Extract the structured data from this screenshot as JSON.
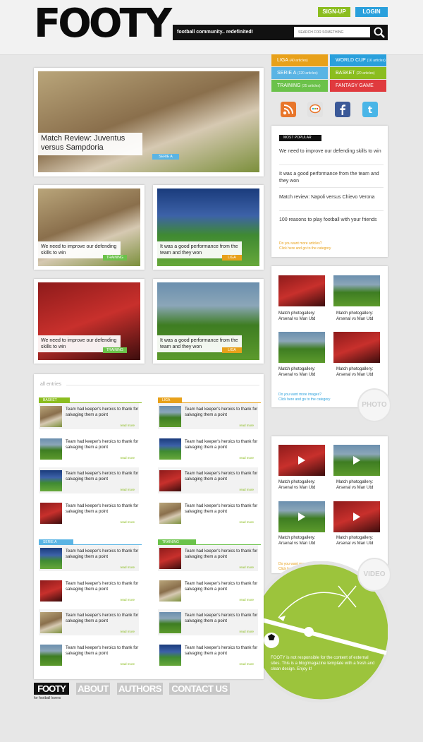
{
  "header": {
    "logo": "FOOTY",
    "signup": "SIGN-UP",
    "login": "LOGIN",
    "tagline": "football community.. redefinited!",
    "search_placeholder": "SEARCH FOR SOMETHING"
  },
  "categories": [
    {
      "label": "LIGA",
      "count": "(40 articles)",
      "color": "#e8a11a"
    },
    {
      "label": "WORLD CUP",
      "count": "(16 articles)",
      "color": "#2aa0dc"
    },
    {
      "label": "SERIE A",
      "count": "(120 articles)",
      "color": "#5ab4e4"
    },
    {
      "label": "BASKET",
      "count": "(20 articles)",
      "color": "#8bbd1f"
    },
    {
      "label": "TRAINING",
      "count": "(25 articles)",
      "color": "#6bc24a"
    },
    {
      "label": "FANTASY GAME",
      "count": "",
      "color": "#e03a3e"
    }
  ],
  "social": [
    {
      "icon": "rss-icon",
      "color": "#e8762b"
    },
    {
      "icon": "chat-bubble-icon",
      "color": "#dcdcdc"
    },
    {
      "icon": "facebook-icon",
      "color": "#3b5998"
    },
    {
      "icon": "twitter-icon",
      "color": "#49b5e7"
    }
  ],
  "featured": {
    "title": "Match Review: Juventus versus Sampdoria",
    "tag": "SERIE A"
  },
  "articles": [
    {
      "title": "We need to improve our defending skills to win",
      "tag": "TRAINING"
    },
    {
      "title": "It was a good performance from the team and they won",
      "tag": "LIGA"
    },
    {
      "title": "We need to improve our defending skills to win",
      "tag": "TRAINING"
    },
    {
      "title": "It was a good performance from the team and they won",
      "tag": "LIGA"
    }
  ],
  "most_popular": {
    "heading": "MOST POPULAR",
    "items": [
      "We need to improve our defending skills to win",
      "It was a good performance from the team and they won",
      "Match review: Napoli versus Chievo Verona",
      "100 reasons to play football with your friends"
    ],
    "more_q": "Do you want more articles?",
    "more_link": "Click here and go to the category"
  },
  "photos": {
    "items": [
      "Match photogallery: Arsenal vs Man Utd",
      "Match photogallery: Arsenal vs Man Utd",
      "Match photogallery: Arsenal vs Man Utd",
      "Match photogallery: Arsenal vs Man Utd"
    ],
    "more_q": "Do you want more images?",
    "more_link": "Click here and go to the category",
    "label": "PHOTO"
  },
  "videos": {
    "items": [
      "Match photogallery: Arsenal vs Man Utd",
      "Match photogallery: Arsenal vs Man Utd",
      "Match photogallery: Arsenal vs Man Utd",
      "Match photogallery: Arsenal vs Man Utd"
    ],
    "more_q": "Do you want more videos?",
    "more_link": "Click here and go to the category",
    "label": "VIDEO"
  },
  "entries": {
    "heading": "all entries",
    "entry_text": "Team had keeper's heroics to thank for salvaging them a point",
    "more": "read more",
    "columns": [
      {
        "tag": "BASKET",
        "color": "#8bbd1f"
      },
      {
        "tag": "LIGA",
        "color": "#e8a11a"
      },
      {
        "tag": "SERIE A",
        "color": "#5ab4e4"
      },
      {
        "tag": "TRAINING",
        "color": "#6bc24a"
      }
    ]
  },
  "disclaimer": "FOOTY is not responsible for the content of external sites. This is a blog/magazine template with a fresh and clean design. Enjoy it!",
  "footer": {
    "logo": "FOOTY",
    "sub": "for football lovers",
    "nav": [
      "ABOUT",
      "AUTHORS",
      "CONTACT US"
    ]
  }
}
